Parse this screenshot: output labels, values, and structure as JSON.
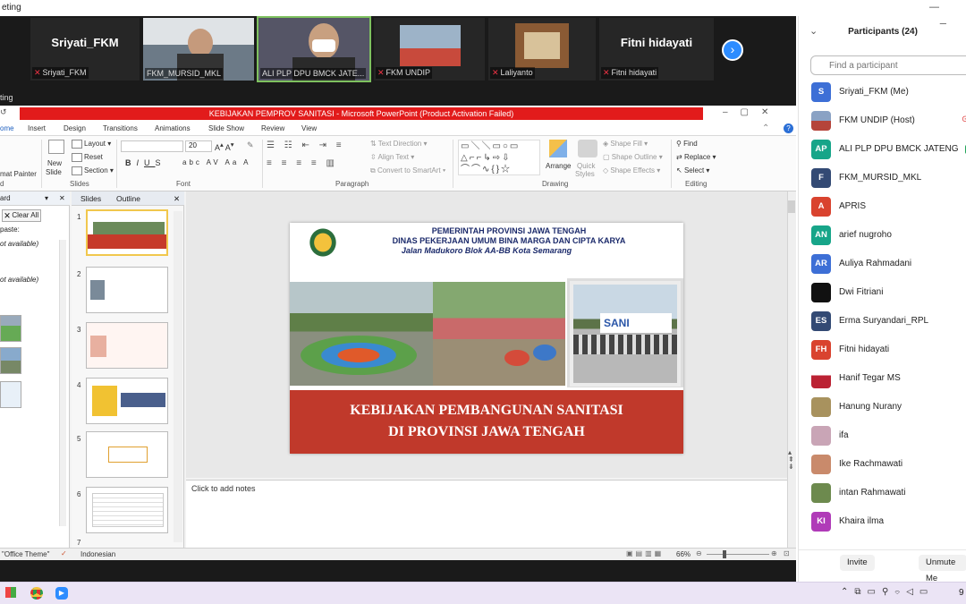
{
  "zoom": {
    "window_title_fragment": "eting",
    "meeting_label_fragment": "ting"
  },
  "video_strip": {
    "tiles": [
      {
        "big_name": "Sriyati_FKM",
        "label": "Sriyati_FKM"
      },
      {
        "big_name": "",
        "label": "FKM_MURSID_MKL"
      },
      {
        "big_name": "",
        "label": "ALI PLP DPU  BMCK JATE..."
      },
      {
        "big_name": "",
        "label": "FKM UNDIP"
      },
      {
        "big_name": "",
        "label": "Laliyanto"
      },
      {
        "big_name": "Fitni hidayati",
        "label": "Fitni hidayati"
      }
    ],
    "next_icon": "chevron-right-icon"
  },
  "ppt": {
    "title": "KEBIJAKAN PEMPROV SANITASI  -  Microsoft PowerPoint (Product Activation Failed)",
    "tabs": [
      "ome",
      "Insert",
      "Design",
      "Transitions",
      "Animations",
      "Slide Show",
      "Review",
      "View"
    ],
    "ribbon": {
      "paste_fragment": "mat Painter",
      "layout": "Layout",
      "reset": "Reset",
      "section": "Section",
      "new_slide": "New",
      "new_slide2": "Slide",
      "font_size": "20",
      "text_direction": "Text Direction",
      "align_text": "Align Text",
      "convert_smartart": "Convert to SmartArt",
      "arrange": "Arrange",
      "quick_styles": "Quick",
      "quick_styles2": "Styles",
      "shape_fill": "Shape Fill",
      "shape_outline": "Shape Outline",
      "shape_effects": "Shape Effects",
      "find": "Find",
      "replace": "Replace",
      "select": "Select",
      "groups": {
        "clipboard": "d",
        "slides": "Slides",
        "font": "Font",
        "paragraph": "Paragraph",
        "drawing": "Drawing",
        "editing": "Editing"
      }
    },
    "clipboard_pane": {
      "title": "ard",
      "clear_all": "Clear All",
      "paste_label": "paste:",
      "item1": "ot available)",
      "item2": "ot available)"
    },
    "slides_pane": {
      "tab_slides": "Slides",
      "tab_outline": "Outline",
      "numbers": [
        "1",
        "2",
        "3",
        "4",
        "5",
        "6",
        "7"
      ]
    },
    "slide": {
      "line1": "PEMERINTAH PROVINSI JAWA TENGAH",
      "line2": "DINAS PEKERJAAN UMUM BINA MARGA DAN CIPTA KARYA",
      "line3": "Jalan Madukoro Blok AA-BB Kota Semarang",
      "banner1": "KEBIJAKAN PEMBANGUNAN SANITASI",
      "banner2": "DI PROVINSI JAWA TENGAH",
      "sign_text": "SANI"
    },
    "notes_placeholder": "Click to add notes",
    "status": {
      "theme": "\"Office Theme\"",
      "language": "Indonesian",
      "zoom": "66%"
    }
  },
  "participants": {
    "title": "Participants (24)",
    "search_placeholder": "Find a participant",
    "list": [
      {
        "initials": "S",
        "name": "Sriyati_FKM (Me)",
        "color": "#3d6fd6"
      },
      {
        "initials": "",
        "name": "FKM UNDIP (Host)",
        "color": "#556f9a"
      },
      {
        "initials": "AP",
        "name": "ALI PLP DPU  BMCK JATENG",
        "color": "#17a589"
      },
      {
        "initials": "F",
        "name": "FKM_MURSID_MKL",
        "color": "#334a74"
      },
      {
        "initials": "A",
        "name": "APRIS",
        "color": "#d9432f"
      },
      {
        "initials": "AN",
        "name": "arief nugroho",
        "color": "#17a589"
      },
      {
        "initials": "AR",
        "name": "Auliya Rahmadani",
        "color": "#3d6fd6"
      },
      {
        "initials": "",
        "name": "Dwi Fitriani",
        "color": "#111111"
      },
      {
        "initials": "ES",
        "name": "Erma Suryandari_RPL",
        "color": "#334a74"
      },
      {
        "initials": "FH",
        "name": "Fitni hidayati",
        "color": "#d9432f"
      },
      {
        "initials": "",
        "name": "Hanif Tegar MS",
        "color": "#b23"
      },
      {
        "initials": "",
        "name": "Hanung Nurany",
        "color": "#a8925e"
      },
      {
        "initials": "",
        "name": "ifa",
        "color": "#c9a5b6"
      },
      {
        "initials": "",
        "name": "Ike Rachmawati",
        "color": "#c98a6b"
      },
      {
        "initials": "",
        "name": "intan Rahmawati",
        "color": "#6d8a4e"
      },
      {
        "initials": "KI",
        "name": "Khaira ilma",
        "color": "#b03bb8"
      }
    ],
    "invite": "Invite",
    "unmute": "Unmute Me"
  },
  "taskbar": {
    "time_fragment": "9"
  }
}
